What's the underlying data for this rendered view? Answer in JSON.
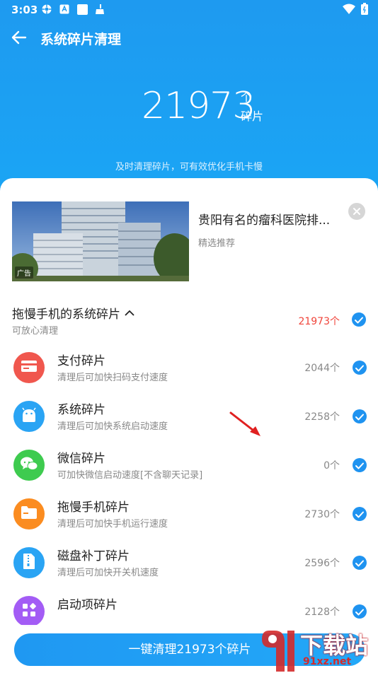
{
  "status_bar": {
    "time": "3:03"
  },
  "header": {
    "title": "系统碎片清理"
  },
  "summary": {
    "count": "21973",
    "unit_top": "个",
    "unit_bottom": "碎片",
    "tagline": "及时清理碎片，可有效优化手机卡慢"
  },
  "ad": {
    "title": "贵阳有名的瘤科医院排...",
    "subtitle": "精选推荐",
    "badge": "广告"
  },
  "group": {
    "title": "拖慢手机的系统碎片",
    "subtitle": "可放心清理",
    "count": "21973个"
  },
  "items": [
    {
      "title": "支付碎片",
      "desc": "清理后可加快扫码支付速度",
      "count": "2044个",
      "icon": "card-icon",
      "color": "#f0574e"
    },
    {
      "title": "系统碎片",
      "desc": "清理后可加快系统启动速度",
      "count": "2258个",
      "icon": "android-icon",
      "color": "#2aa4f4"
    },
    {
      "title": "微信碎片",
      "desc": "可加快微信启动速度[不含聊天记录]",
      "count": "0个",
      "icon": "wechat-icon",
      "color": "#3ecb4f"
    },
    {
      "title": "拖慢手机碎片",
      "desc": "清理后可加快手机运行速度",
      "count": "2730个",
      "icon": "folder-icon",
      "color": "#fb8c20"
    },
    {
      "title": "磁盘补丁碎片",
      "desc": "清理后可加快开关机速度",
      "count": "2596个",
      "icon": "zip-icon",
      "color": "#2aa4f4"
    },
    {
      "title": "启动项碎片",
      "desc": "",
      "count": "2128个",
      "icon": "apps-icon",
      "color": "#a35cf5"
    }
  ],
  "action": {
    "label": "一键清理21973个碎片"
  },
  "watermark": {
    "big": "下载站",
    "small": "91xz.net"
  },
  "colors": {
    "primary": "#1f93f0",
    "danger": "#f0443a"
  }
}
